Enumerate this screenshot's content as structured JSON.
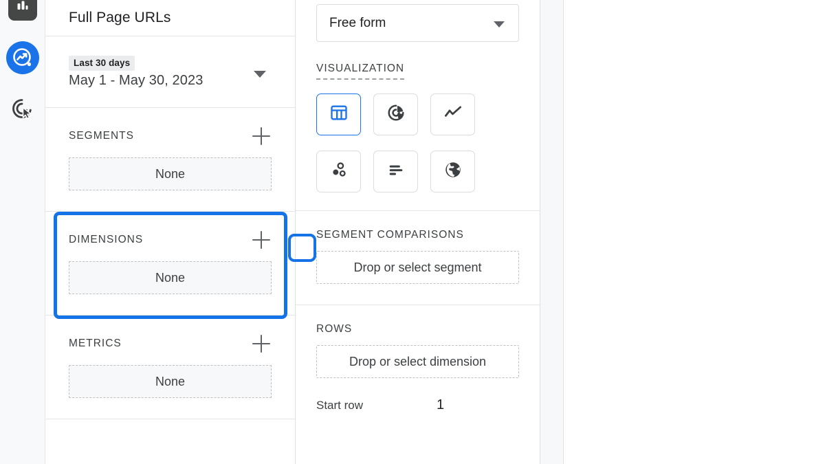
{
  "rail": {
    "icons": [
      {
        "name": "bar-chart-icon",
        "label": "Analytics"
      },
      {
        "name": "explore-analytics-icon",
        "label": "Explorations"
      },
      {
        "name": "target-cursor-icon",
        "label": "Advertising"
      }
    ]
  },
  "left_panel": {
    "title": "Full Page URLs",
    "date": {
      "badge": "Last 30 days",
      "range": "May 1 - May 30, 2023"
    },
    "segments": {
      "label": "SEGMENTS",
      "add_label": "+",
      "value": "None"
    },
    "dimensions": {
      "label": "DIMENSIONS",
      "add_label": "+",
      "value": "None",
      "highlighted": true
    },
    "metrics": {
      "label": "METRICS",
      "add_label": "+",
      "value": "None"
    }
  },
  "right_panel": {
    "technique": {
      "value": "Free form"
    },
    "visualization": {
      "label": "VISUALIZATION",
      "tiles": [
        {
          "name": "free-form-table-icon",
          "selected": true
        },
        {
          "name": "donut-chart-icon",
          "selected": false
        },
        {
          "name": "line-chart-icon",
          "selected": false
        },
        {
          "name": "scatter-plot-icon",
          "selected": false
        },
        {
          "name": "bar-chart-icon",
          "selected": false
        },
        {
          "name": "geo-map-icon",
          "selected": false
        }
      ]
    },
    "segment_comparisons": {
      "label": "SEGMENT COMPARISONS",
      "dropzone": "Drop or select segment"
    },
    "rows": {
      "label": "ROWS",
      "dropzone": "Drop or select dimension",
      "start_row_label": "Start row",
      "start_row_value": "1"
    }
  },
  "colors": {
    "accent_blue": "#1a73e8",
    "highlight_blue": "#1473e6",
    "icon_gray": "#5f6368",
    "border_gray": "#dadce0"
  }
}
